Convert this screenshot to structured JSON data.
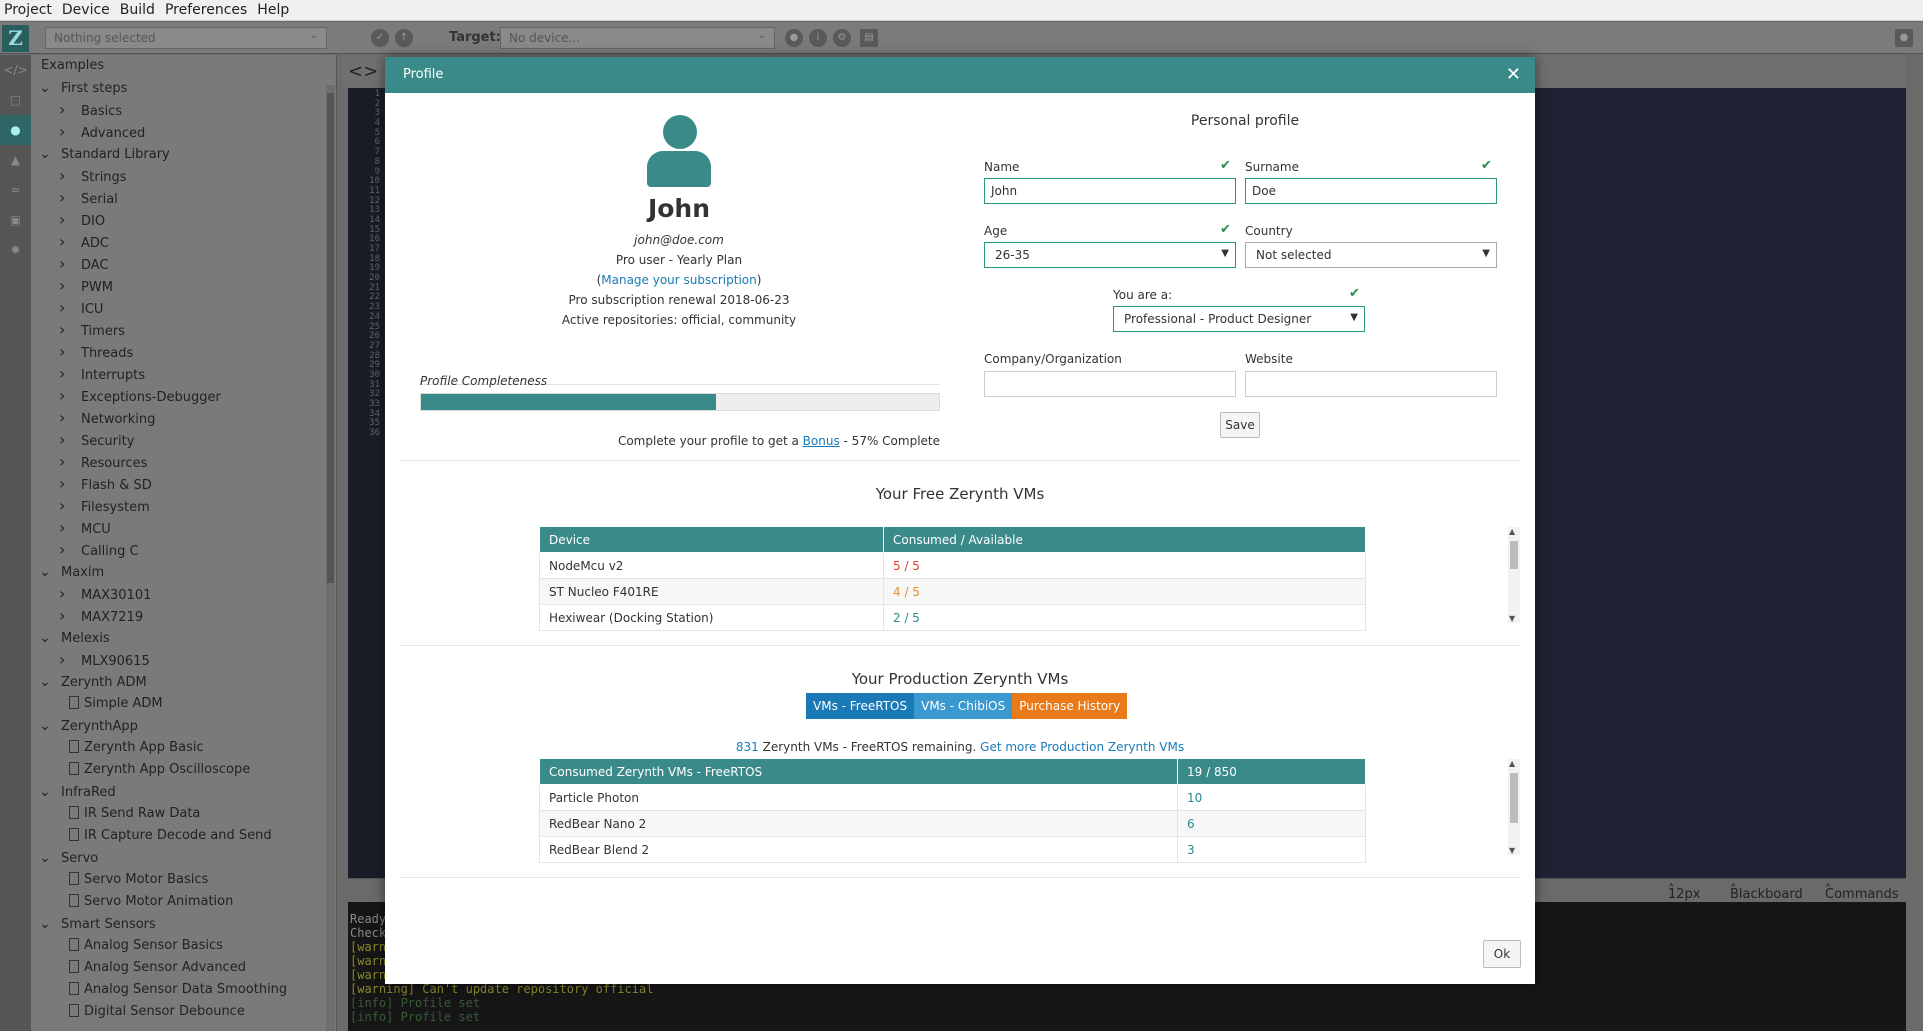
{
  "menu": [
    "Project",
    "Device",
    "Build",
    "Preferences",
    "Help"
  ],
  "toolbar": {
    "project_select": "Nothing selected",
    "target_label": "Target:",
    "device_select": "No device..."
  },
  "sidebar": {
    "title": "Examples",
    "items": [
      {
        "label": "First steps",
        "level": 0,
        "type": "folder-open"
      },
      {
        "label": "Basics",
        "level": 1,
        "type": "folder-closed"
      },
      {
        "label": "Advanced",
        "level": 1,
        "type": "folder-closed"
      },
      {
        "label": "Standard Library",
        "level": 0,
        "type": "folder-open"
      },
      {
        "label": "Strings",
        "level": 1,
        "type": "folder-closed"
      },
      {
        "label": "Serial",
        "level": 1,
        "type": "folder-closed"
      },
      {
        "label": "DIO",
        "level": 1,
        "type": "folder-closed"
      },
      {
        "label": "ADC",
        "level": 1,
        "type": "folder-closed"
      },
      {
        "label": "DAC",
        "level": 1,
        "type": "folder-closed"
      },
      {
        "label": "PWM",
        "level": 1,
        "type": "folder-closed"
      },
      {
        "label": "ICU",
        "level": 1,
        "type": "folder-closed"
      },
      {
        "label": "Timers",
        "level": 1,
        "type": "folder-closed"
      },
      {
        "label": "Threads",
        "level": 1,
        "type": "folder-closed"
      },
      {
        "label": "Interrupts",
        "level": 1,
        "type": "folder-closed"
      },
      {
        "label": "Exceptions-Debugger",
        "level": 1,
        "type": "folder-closed"
      },
      {
        "label": "Networking",
        "level": 1,
        "type": "folder-closed"
      },
      {
        "label": "Security",
        "level": 1,
        "type": "folder-closed"
      },
      {
        "label": "Resources",
        "level": 1,
        "type": "folder-closed"
      },
      {
        "label": "Flash & SD",
        "level": 1,
        "type": "folder-closed"
      },
      {
        "label": "Filesystem",
        "level": 1,
        "type": "folder-closed"
      },
      {
        "label": "MCU",
        "level": 1,
        "type": "folder-closed"
      },
      {
        "label": "Calling C",
        "level": 1,
        "type": "folder-closed"
      },
      {
        "label": "Maxim",
        "level": 0,
        "type": "folder-open"
      },
      {
        "label": "MAX30101",
        "level": 1,
        "type": "folder-closed"
      },
      {
        "label": "MAX7219",
        "level": 1,
        "type": "folder-closed"
      },
      {
        "label": "Melexis",
        "level": 0,
        "type": "folder-open"
      },
      {
        "label": "MLX90615",
        "level": 1,
        "type": "folder-closed"
      },
      {
        "label": "Zerynth ADM",
        "level": 0,
        "type": "folder-open"
      },
      {
        "label": "Simple ADM",
        "level": 1,
        "type": "file"
      },
      {
        "label": "ZerynthApp",
        "level": 0,
        "type": "folder-open"
      },
      {
        "label": "Zerynth App Basic",
        "level": 1,
        "type": "file"
      },
      {
        "label": "Zerynth App Oscilloscope",
        "level": 1,
        "type": "file"
      },
      {
        "label": "InfraRed",
        "level": 0,
        "type": "folder-open"
      },
      {
        "label": "IR Send Raw Data",
        "level": 1,
        "type": "file"
      },
      {
        "label": "IR Capture Decode and Send",
        "level": 1,
        "type": "file"
      },
      {
        "label": "Servo",
        "level": 0,
        "type": "folder-open"
      },
      {
        "label": "Servo Motor Basics",
        "level": 1,
        "type": "file"
      },
      {
        "label": "Servo Motor Animation",
        "level": 1,
        "type": "file"
      },
      {
        "label": "Smart Sensors",
        "level": 0,
        "type": "folder-open"
      },
      {
        "label": "Analog Sensor Basics",
        "level": 1,
        "type": "file"
      },
      {
        "label": "Analog Sensor Advanced",
        "level": 1,
        "type": "file"
      },
      {
        "label": "Analog Sensor Data Smoothing",
        "level": 1,
        "type": "file"
      },
      {
        "label": "Digital Sensor Debounce",
        "level": 1,
        "type": "file"
      }
    ]
  },
  "gutter_lines": [
    "1",
    "2",
    "3",
    "4",
    "5",
    "6",
    "7",
    "8",
    "9",
    "10",
    "11",
    "12",
    "13",
    "14",
    "15",
    "16",
    "17",
    "18",
    "19",
    "20",
    "21",
    "22",
    "23",
    "24",
    "25",
    "26",
    "27",
    "28",
    "29",
    "30",
    "31",
    "32",
    "33",
    "34",
    "35",
    "36"
  ],
  "statusbar": {
    "font_size": "12px",
    "theme": "Blackboard",
    "commands": "Commands"
  },
  "console": {
    "lines": [
      {
        "text": "Ready",
        "kind": "plain"
      },
      {
        "text": "Check",
        "kind": "plain"
      },
      {
        "text": "[warn",
        "kind": "warn"
      },
      {
        "text": "[warn",
        "kind": "warn"
      },
      {
        "text": "[warn",
        "kind": "warn"
      },
      {
        "text": "[warning] Can't update repository official",
        "kind": "warn"
      },
      {
        "text": "[info] Profile set",
        "kind": "info"
      },
      {
        "text": "[info] Profile set",
        "kind": "info"
      }
    ]
  },
  "modal": {
    "title": "Profile",
    "profile": {
      "name": "John",
      "email": "john@doe.com",
      "plan": "Pro user - Yearly Plan",
      "manage_open": "(",
      "manage_link": "Manage your subscription",
      "manage_close": ")",
      "renewal": "Pro subscription renewal 2018-06-23",
      "repositories": "Active repositories: official, community",
      "completeness_label": "Profile Completeness",
      "completeness_pct": 57,
      "complete_prefix": "Complete your profile to get a ",
      "complete_link": "Bonus",
      "complete_suffix": " - 57% Complete"
    },
    "form": {
      "title": "Personal profile",
      "name_label": "Name",
      "name_value": "John",
      "surname_label": "Surname",
      "surname_value": "Doe",
      "age_label": "Age",
      "age_value": "26-35",
      "country_label": "Country",
      "country_value": "Not selected",
      "youare_label": "You are a:",
      "youare_value": "Professional - Product Designer",
      "company_label": "Company/Organization",
      "company_value": "",
      "website_label": "Website",
      "website_value": "",
      "save_label": "Save"
    },
    "free_vms": {
      "title": "Your Free Zerynth VMs",
      "headers": [
        "Device",
        "Consumed / Available"
      ],
      "rows": [
        {
          "device": "NodeMcu v2",
          "usage": "5 / 5",
          "color": "#e03a2a"
        },
        {
          "device": "ST Nucleo F401RE",
          "usage": "4 / 5",
          "color": "#e8912a"
        },
        {
          "device": "Hexiwear (Docking Station)",
          "usage": "2 / 5",
          "color": "#2a8a8a"
        }
      ]
    },
    "prod_vms": {
      "title": "Your Production Zerynth VMs",
      "tabs": [
        {
          "label": "VMs - FreeRTOS",
          "color": "#1a7ab8"
        },
        {
          "label": "VMs - ChibiOS",
          "color": "#3a9ad0"
        },
        {
          "label": "Purchase History",
          "color": "#e87a1a"
        }
      ],
      "remaining_count": "831",
      "remaining_text": " Zerynth VMs - FreeRTOS remaining. ",
      "remaining_link": "Get more Production Zerynth VMs",
      "headers": [
        "Consumed Zerynth VMs - FreeRTOS",
        "19 / 850"
      ],
      "rows": [
        {
          "device": "Particle Photon",
          "count": "10"
        },
        {
          "device": "RedBear Nano 2",
          "count": "6"
        },
        {
          "device": "RedBear Blend 2",
          "count": "3"
        }
      ]
    },
    "ok_label": "Ok"
  }
}
